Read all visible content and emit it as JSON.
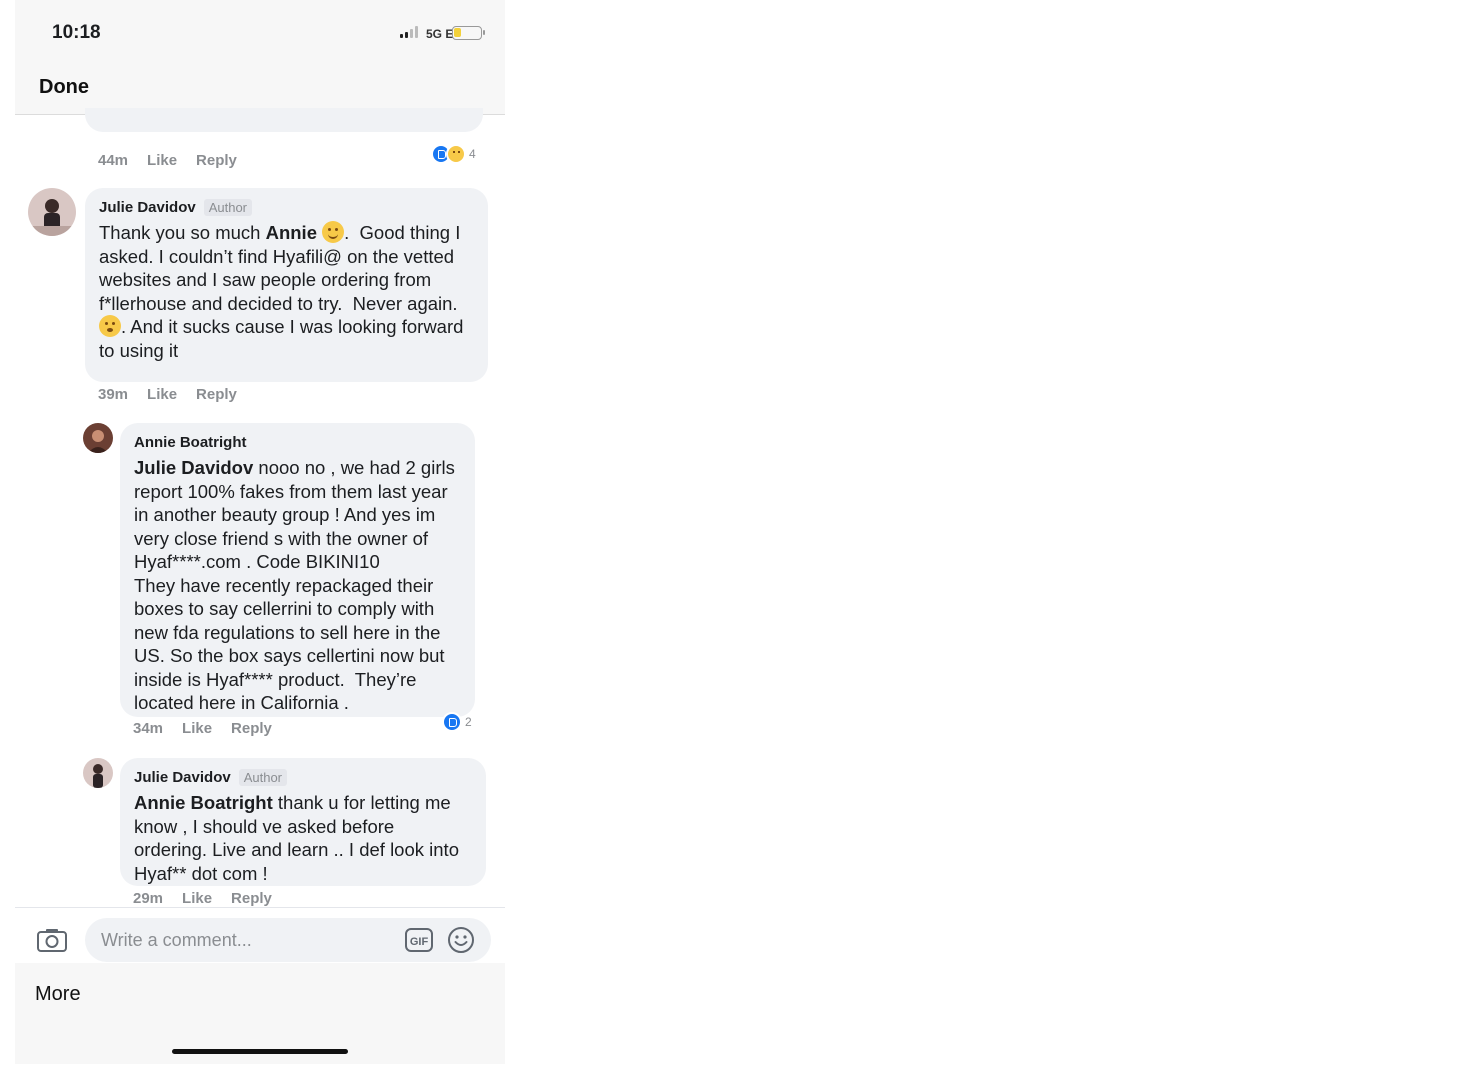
{
  "status_bar": {
    "time": "10:18",
    "network": "5G E",
    "battery_level": 0.3
  },
  "header": {
    "done_label": "Done"
  },
  "previous_comment": {
    "time": "44m",
    "like": "Like",
    "reply": "Reply",
    "reaction_count": "4"
  },
  "comments": [
    {
      "author": "Julie Davidov",
      "badge": "Author",
      "mention": "Annie",
      "text_a": "Thank you so much ",
      "text_b": ".  Good thing I asked. I couldn’t find Hyafili@ on the vetted websites and I saw people ordering from f*llerhouse and decided to try.  Never again. ",
      "text_c": ". And it sucks cause I was looking forward to using it",
      "time": "39m",
      "like": "Like",
      "reply": "Reply"
    },
    {
      "author": "Annie Boatright",
      "mention": "Julie Davidov",
      "text": " nooo no , we had 2 girls report 100% fakes from them last year in another beauty group ! And yes im very close friend s with the owner of Hyaf****.com . Code BIKINI10\nThey have recently repackaged their boxes to say cellerrini to comply with new fda regulations to sell here in the US. So the box says cellertini now but inside is Hyaf**** product.  They’re located here in California .",
      "time": "34m",
      "like": "Like",
      "reply": "Reply",
      "reaction_count": "2"
    },
    {
      "author": "Julie Davidov",
      "badge": "Author",
      "mention": "Annie Boatright",
      "text": " thank u for letting me know , I should ve asked before ordering. Live and learn .. I def look into Hyaf** dot com !",
      "time": "29m",
      "like": "Like",
      "reply": "Reply"
    }
  ],
  "composer": {
    "placeholder": "Write a comment...",
    "gif_label": "GIF"
  },
  "footer": {
    "more_label": "More"
  },
  "icons": [
    "camera-icon",
    "gif-icon",
    "emoji-icon",
    "like-reaction-icon",
    "sad-reaction-icon"
  ],
  "colors": {
    "accent": "#1877f2",
    "bubble": "#f0f2f5",
    "meta_text": "#8a8d91"
  }
}
